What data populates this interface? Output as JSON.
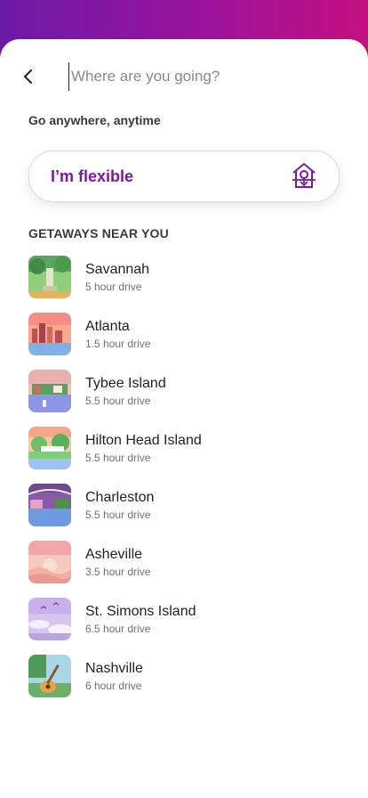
{
  "search": {
    "placeholder": "Where are you going?"
  },
  "intro": {
    "go_anywhere": "Go anywhere, anytime"
  },
  "flexible": {
    "label": "I’m flexible"
  },
  "getaways": {
    "heading": "GETAWAYS NEAR YOU",
    "items": [
      {
        "city": "Savannah",
        "drive": "5 hour drive"
      },
      {
        "city": "Atlanta",
        "drive": "1.5 hour drive"
      },
      {
        "city": "Tybee Island",
        "drive": "5.5 hour drive"
      },
      {
        "city": "Hilton Head Island",
        "drive": "5.5 hour drive"
      },
      {
        "city": "Charleston",
        "drive": "5.5 hour drive"
      },
      {
        "city": "Asheville",
        "drive": "3.5 hour drive"
      },
      {
        "city": "St. Simons Island",
        "drive": "6.5 hour drive"
      },
      {
        "city": "Nashville",
        "drive": "6 hour drive"
      }
    ]
  },
  "colors": {
    "header_gradient_start": "#6c1aa8",
    "header_gradient_end": "#c4107f",
    "accent": "#7a1aa0"
  },
  "icons": {
    "back": "chevron-left-icon",
    "flexible": "house-compass-icon"
  }
}
